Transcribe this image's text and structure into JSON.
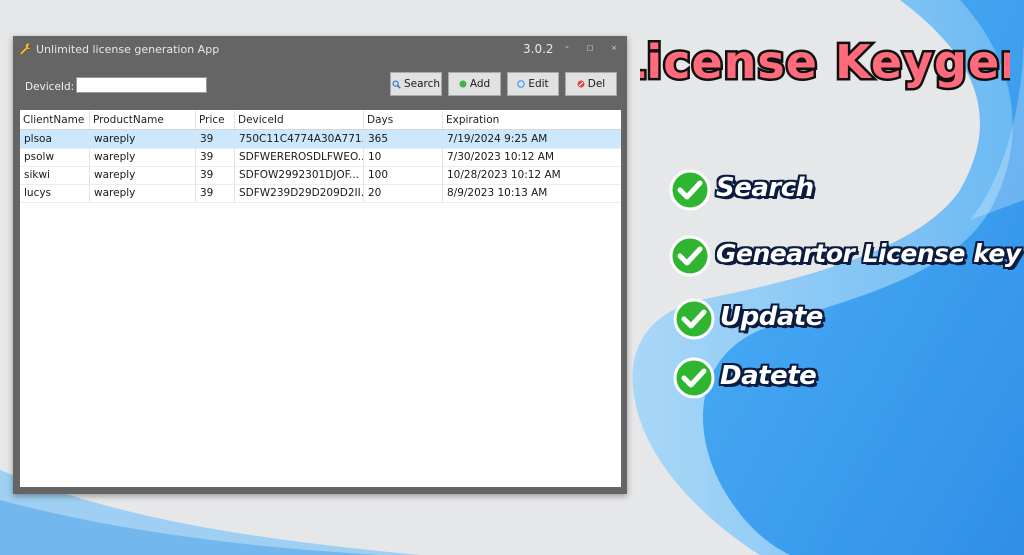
{
  "window": {
    "title": "Unlimited license generation App",
    "version": "3.0.2",
    "controls": {
      "minimize": "-",
      "maximize": "□",
      "close": "×"
    }
  },
  "toolbar": {
    "device_label": "DeviceId:",
    "device_value": "",
    "search_label": "Search",
    "add_label": "Add",
    "edit_label": "Edit",
    "del_label": "Del"
  },
  "grid": {
    "columns": [
      "ClientName",
      "ProductName",
      "Price",
      "DeviceId",
      "Days",
      "Expiration"
    ],
    "rows": [
      [
        "plsoa",
        "wareply",
        "39",
        "750C11C4774A30A771...",
        "365",
        "7/19/2024 9:25 AM"
      ],
      [
        "psolw",
        "wareply",
        "39",
        "SDFWEREROSDLFWEO...",
        "10",
        "7/30/2023 10:12 AM"
      ],
      [
        "sikwi",
        "wareply",
        "39",
        "SDFOW2992301DJOF...",
        "100",
        "10/28/2023 10:12 AM"
      ],
      [
        "lucys",
        "wareply",
        "39",
        "SDFW239D29D209D2II...",
        "20",
        "8/9/2023 10:13 AM"
      ]
    ],
    "selected_row": 0
  },
  "promo": {
    "title": "License Keygen",
    "features": [
      "Search",
      "Geneartor License key",
      "Update",
      "Datete"
    ]
  },
  "colors": {
    "title_fill": "#ff6b7a",
    "title_outline": "#111111",
    "check_green": "#2fb52f",
    "wave_blue": "#3aa0f2",
    "selection": "#cce8ff"
  },
  "icons": [
    "wrench-icon",
    "search-icon",
    "add-icon",
    "edit-icon",
    "delete-icon",
    "checkmark-icon"
  ]
}
